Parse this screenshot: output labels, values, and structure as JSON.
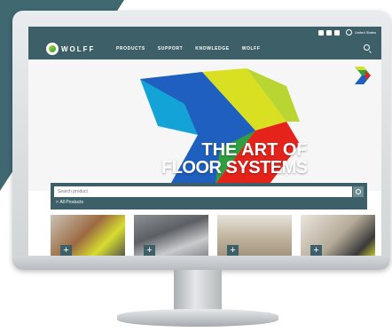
{
  "topbar": {
    "social_icons": [
      "facebook-icon",
      "instagram-icon",
      "youtube-icon"
    ],
    "region_label": "United States",
    "logo_text": "WOLFF",
    "nav": [
      "PRODUCTS",
      "SUPPORT",
      "KNOWLEDGE",
      "WOLFF"
    ]
  },
  "hero": {
    "headline_line1": "THE ART OF",
    "headline_line2": "FLOOR SYSTEMS"
  },
  "search": {
    "placeholder": "Search product",
    "breadcrumb": "All Products"
  },
  "products": [
    {
      "icon": "plus-icon",
      "label": "+"
    },
    {
      "icon": "plus-icon",
      "label": "+"
    },
    {
      "icon": "plus-icon",
      "label": "+"
    },
    {
      "icon": "plus-icon",
      "label": "+"
    }
  ],
  "colors": {
    "brand_teal": "#3d5f67",
    "accent_green": "#2f9f42",
    "accent_yellow": "#d8e021",
    "accent_red": "#e5231b",
    "accent_blue": "#1f5fbf"
  }
}
